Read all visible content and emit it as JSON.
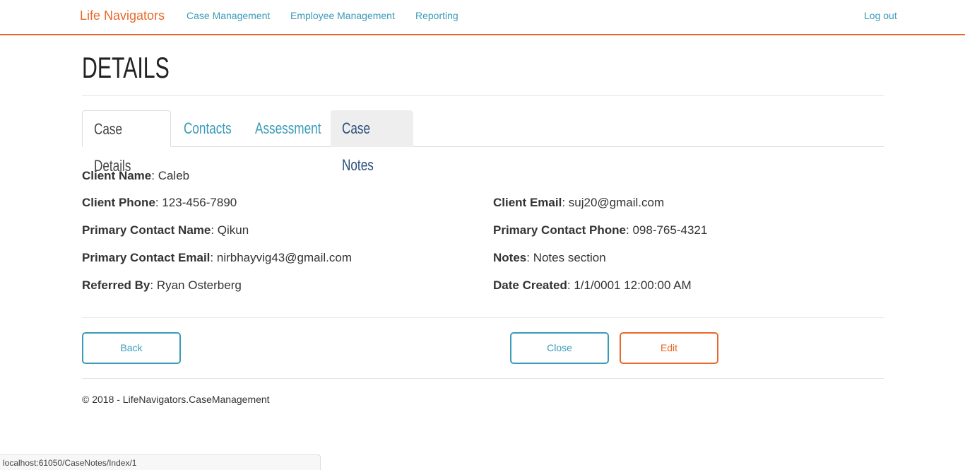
{
  "nav": {
    "brand": "Life Navigators",
    "links": [
      "Case Management",
      "Employee Management",
      "Reporting"
    ],
    "logout": "Log out"
  },
  "page_title": "DETAILS",
  "tabs": [
    "Case Details",
    "Contacts",
    "Assessment",
    "Case Notes"
  ],
  "fields": [
    {
      "label": "Client Name",
      "value": "Caleb"
    },
    {
      "label": "Client Phone",
      "value": "123-456-7890"
    },
    {
      "label": "Client Email",
      "value": "suj20@gmail.com"
    },
    {
      "label": "Primary Contact Name",
      "value": "Qikun"
    },
    {
      "label": "Primary Contact Phone",
      "value": "098-765-4321"
    },
    {
      "label": "Primary Contact Email",
      "value": "nirbhayvig43@gmail.com"
    },
    {
      "label": "Notes",
      "value": "Notes section"
    },
    {
      "label": "Referred By",
      "value": "Ryan Osterberg"
    },
    {
      "label": "Date Created",
      "value": "1/1/0001 12:00:00 AM"
    }
  ],
  "buttons": {
    "back": "Back",
    "close": "Close",
    "edit": "Edit"
  },
  "footer": "© 2018 - LifeNavigators.CaseManagement",
  "status_url": "localhost:61050/CaseNotes/Index/1",
  "colors": {
    "brand": "#e8692b",
    "link": "#3a9bb8"
  }
}
